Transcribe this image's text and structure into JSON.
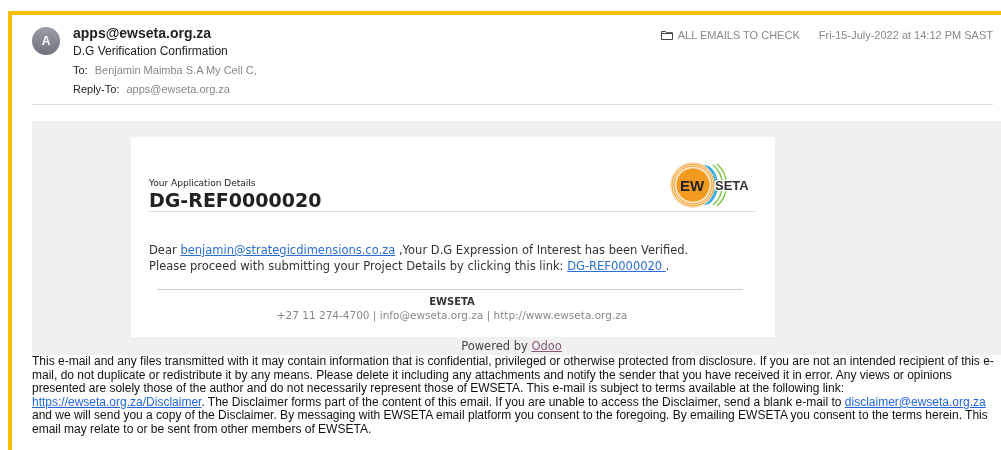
{
  "header": {
    "avatar": "A",
    "sender": "apps@ewseta.org.za",
    "subject": "D.G Verification Confirmation",
    "to_label": "To:",
    "to": "Benjamin Maimba S.A My Cell C,",
    "reply_to_label": "Reply-To:",
    "reply_to": "apps@ewseta.org.za",
    "folder": "ALL EMAILS TO CHECK",
    "date": "Fri-15-July-2022 at 14:12 PM SAST"
  },
  "card": {
    "kicker": "Your Application Details",
    "reference": "DG-REF0000020",
    "logo": {
      "left": "EW",
      "right": "SETA"
    },
    "greeting": "Dear",
    "email_link": "benjamin@strategicdimensions.co.za",
    "after_email": " ,Your D.G Expression of Interest has been Verified.",
    "line2": "Please proceed with submitting your Project Details by clicking this link:",
    "link": "DG-REF0000020 ",
    "end": ".",
    "footer_name": "EWSETA",
    "contact": "+27 11 274-4700 | info@ewseta.org.za | http://www.ewseta.org.za"
  },
  "powered": {
    "text": "Powered by",
    "link": "Odoo"
  },
  "disclaimer": [
    {
      "kind": "text",
      "text": "This e-mail and any files transmitted with it may contain information that is confidential, privileged or otherwise protected from disclosure. If you are not an intended recipient of this e-mail, do not duplicate or redistribute it by any means. Please delete it including any attachments and notify the sender that you have received it in error. Any views or opinions presented are solely those of the author and do not necessarily represent those of EWSETA. This e-mail is subject to terms available at the following link: "
    },
    {
      "kind": "link",
      "text": "https://ewseta.org.za/Disclaimer"
    },
    {
      "kind": "text",
      "text": ". The Disclaimer forms part of the content of this email. If you are unable to access the Disclaimer, send a blank e-mail to "
    },
    {
      "kind": "link",
      "text": "disclaimer@ewseta.org.za"
    },
    {
      "kind": "text",
      "text": " and we will send you a copy of the Disclaimer. By messaging with EWSETA email platform you consent to the foregoing. By emailing EWSETA you consent to the terms herein. This email may relate to or be sent from other members of EWSETA."
    }
  ]
}
